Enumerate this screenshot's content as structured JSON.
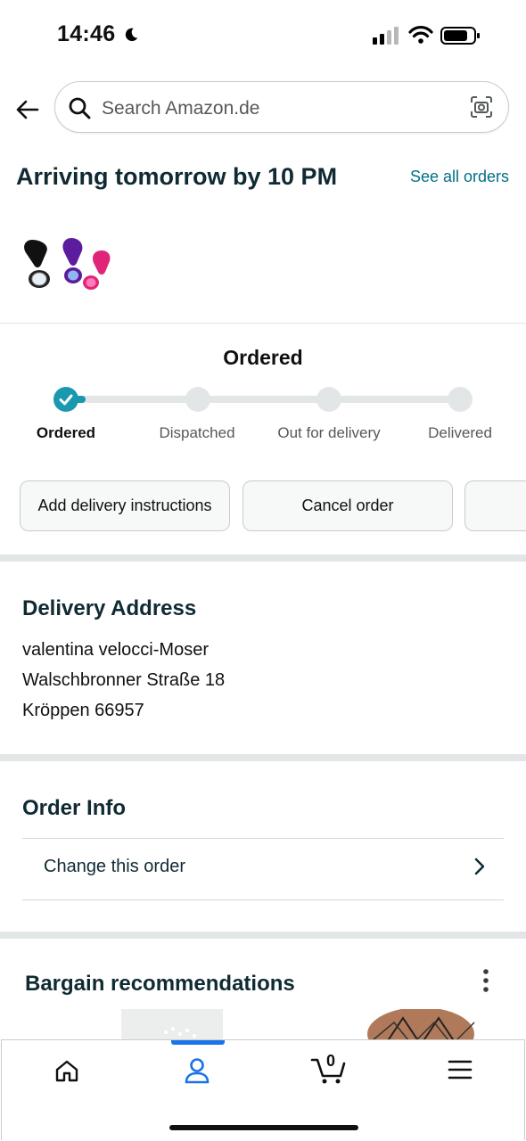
{
  "status_bar": {
    "time": "14:46"
  },
  "search": {
    "placeholder": "Search Amazon.de"
  },
  "header": {
    "arrival": "Arriving tomorrow by 10 PM",
    "see_all": "See all orders"
  },
  "tracking": {
    "current": "Ordered",
    "steps": [
      "Ordered",
      "Dispatched",
      "Out for delivery",
      "Delivered"
    ],
    "progress_step": 1
  },
  "actions": [
    "Add delivery instructions",
    "Cancel order"
  ],
  "delivery": {
    "title": "Delivery Address",
    "lines": [
      "valentina velocci-Moser",
      "Walschbronner Straße 18",
      "Kröppen 66957"
    ]
  },
  "order_info": {
    "title": "Order Info",
    "change": "Change this order"
  },
  "recommendations": {
    "title": "Bargain recommendations"
  },
  "cart": {
    "count": "0"
  },
  "colors": {
    "accent": "#007185",
    "teal_dot": "#1a98b0",
    "nav_active": "#1a73e8"
  }
}
